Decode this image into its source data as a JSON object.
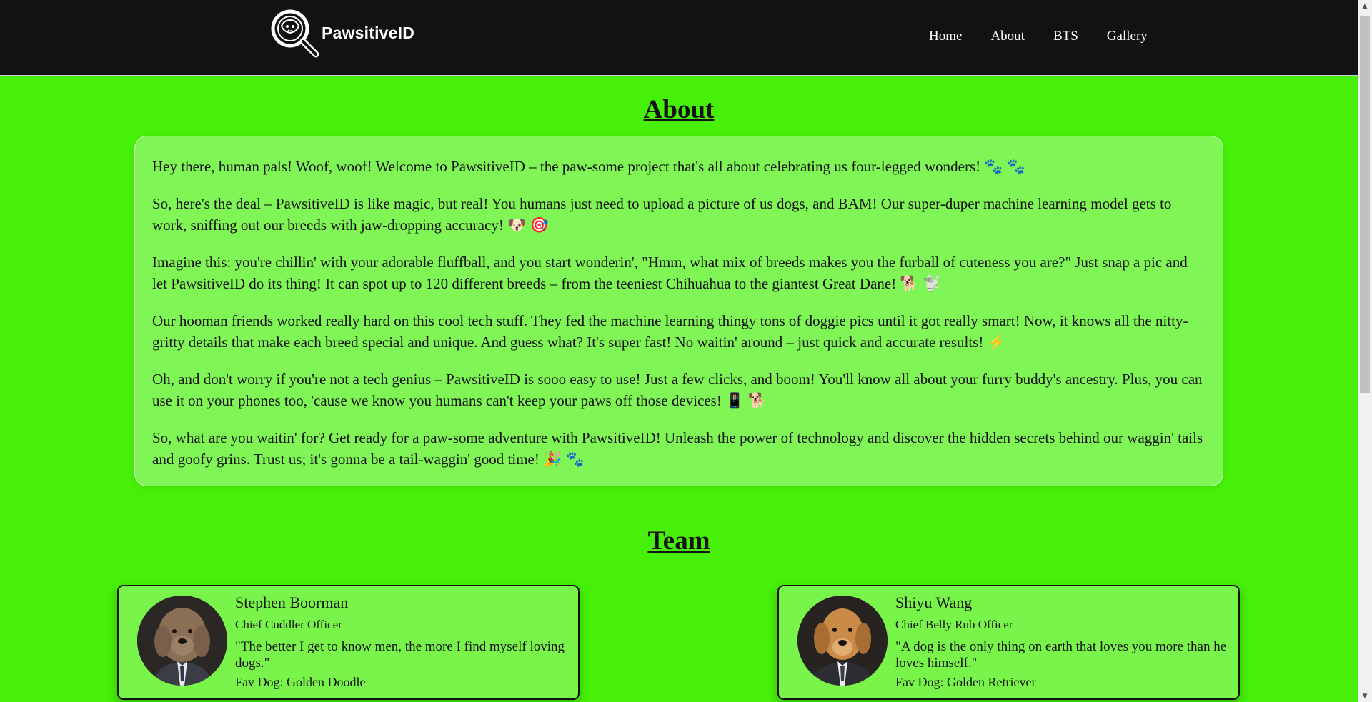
{
  "header": {
    "brand": "PawsitiveID",
    "nav": [
      "Home",
      "About",
      "BTS",
      "Gallery"
    ]
  },
  "about": {
    "title": "About",
    "paragraphs": [
      "Hey there, human pals! Woof, woof! Welcome to PawsitiveID – the paw-some project that's all about celebrating us four-legged wonders! 🐾 🐾",
      "So, here's the deal – PawsitiveID is like magic, but real! You humans just need to upload a picture of us dogs, and BAM! Our super-duper machine learning model gets to work, sniffing out our breeds with jaw-dropping accuracy! 🐶 🎯",
      "Imagine this: you're chillin' with your adorable fluffball, and you start wonderin', \"Hmm, what mix of breeds makes you the furball of cuteness you are?\" Just snap a pic and let PawsitiveID do its thing! It can spot up to 120 different breeds – from the teeniest Chihuahua to the giantest Great Dane! 🐕 🐩",
      "Our hooman friends worked really hard on this cool tech stuff. They fed the machine learning thingy tons of doggie pics until it got really smart! Now, it knows all the nitty-gritty details that make each breed special and unique. And guess what? It's super fast! No waitin' around – just quick and accurate results! ⚡",
      "Oh, and don't worry if you're not a tech genius – PawsitiveID is sooo easy to use! Just a few clicks, and boom! You'll know all about your furry buddy's ancestry. Plus, you can use it on your phones too, 'cause we know you humans can't keep your paws off those devices! 📱 🐕",
      "So, what are you waitin' for? Get ready for a paw-some adventure with PawsitiveID! Unleash the power of technology and discover the hidden secrets behind our waggin' tails and goofy grins. Trust us; it's gonna be a tail-waggin' good time! 🎉 🐾"
    ]
  },
  "team": {
    "title": "Team",
    "members": [
      {
        "name": "Stephen Boorman",
        "role": "Chief Cuddler Officer",
        "quote": "\"The better I get to know men, the more I find myself loving dogs.\"",
        "fav": "Fav Dog: Golden Doodle",
        "avatar_icon": "dog-in-suit-portrait"
      },
      {
        "name": "Shiyu Wang",
        "role": "Chief Belly Rub Officer",
        "quote": "\"A dog is the only thing on earth that loves you more than he loves himself.\"",
        "fav": "Fav Dog: Golden Retriever",
        "avatar_icon": "dog-in-suit-portrait"
      }
    ]
  },
  "colors": {
    "page_bg": "#46f008",
    "card_bg": "#80f556",
    "header_bg": "#121212"
  }
}
